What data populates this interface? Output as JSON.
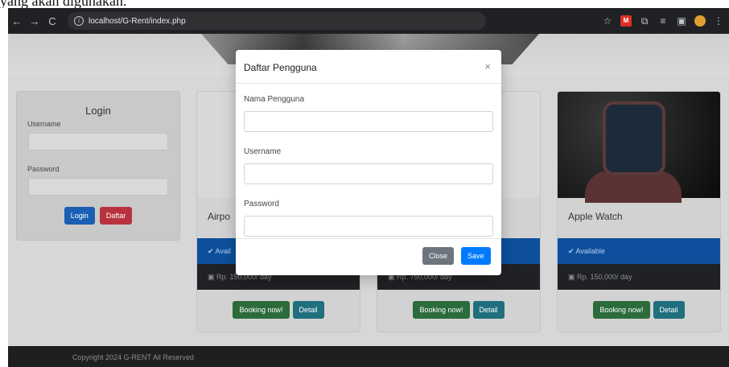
{
  "top_text": "yang akan digunakan.",
  "browser": {
    "url": "localhost/G-Rent/index.php"
  },
  "login": {
    "title": "Login",
    "username_label": "Username",
    "password_label": "Password",
    "login_btn": "Login",
    "register_btn": "Daftar"
  },
  "cards": [
    {
      "name": "Airpo",
      "status": "Avail",
      "price": "Rp. 150,000/ day",
      "booking": "Booking now!",
      "detail": "Detail"
    },
    {
      "name": "",
      "status": "",
      "price": "Rp. 750,000/ day",
      "booking": "Booking now!",
      "detail": "Detail"
    },
    {
      "name": "Apple Watch",
      "status": "Available",
      "price": "Rp. 150,000/ day",
      "booking": "Booking now!",
      "detail": "Detail"
    }
  ],
  "footer": "Copyright 2024 G-RENT All Reserved",
  "modal": {
    "title": "Daftar Pengguna",
    "close_icon": "×",
    "f1": "Nama Pengguna",
    "f2": "Username",
    "f3": "Password",
    "close_btn": "Close",
    "save_btn": "Save"
  },
  "colors": {
    "primary": "#007bff",
    "success": "#1e7e34",
    "danger": "#c82333",
    "info": "#17a2b8"
  }
}
